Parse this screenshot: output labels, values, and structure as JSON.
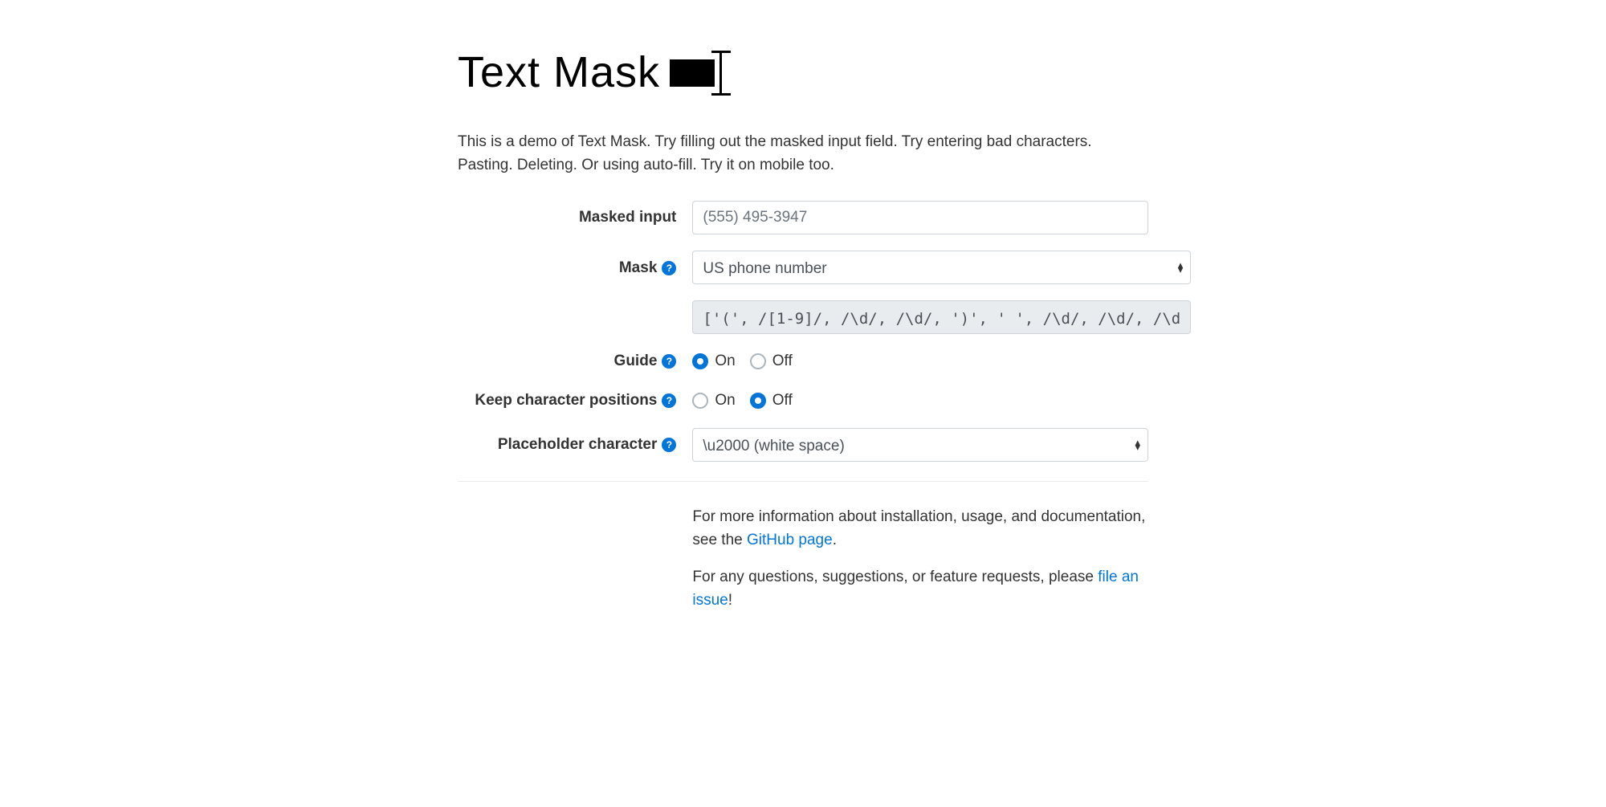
{
  "header": {
    "title": "Text Mask"
  },
  "intro": "This is a demo of Text Mask. Try filling out the masked input field. Try entering bad characters. Pasting. Deleting. Or using auto-fill. Try it on mobile too.",
  "form": {
    "masked_input": {
      "label": "Masked input",
      "placeholder": "(555) 495-3947",
      "value": ""
    },
    "mask": {
      "label": "Mask",
      "selected": "US phone number",
      "definition": "['(', /[1-9]/, /\\d/, /\\d/, ')', ' ', /\\d/, /\\d/, /\\d"
    },
    "guide": {
      "label": "Guide",
      "on": "On",
      "off": "Off",
      "value": "on"
    },
    "keep_char_positions": {
      "label": "Keep character positions",
      "on": "On",
      "off": "Off",
      "value": "off"
    },
    "placeholder_char": {
      "label": "Placeholder character",
      "selected": "\\u2000 (white space)"
    }
  },
  "footer": {
    "info_prefix": "For more information about installation, usage, and documentation, see the ",
    "info_link": "GitHub page",
    "info_suffix": ".",
    "issue_prefix": "For any questions, suggestions, or feature requests, please ",
    "issue_link": "file an issue",
    "issue_suffix": "!"
  }
}
